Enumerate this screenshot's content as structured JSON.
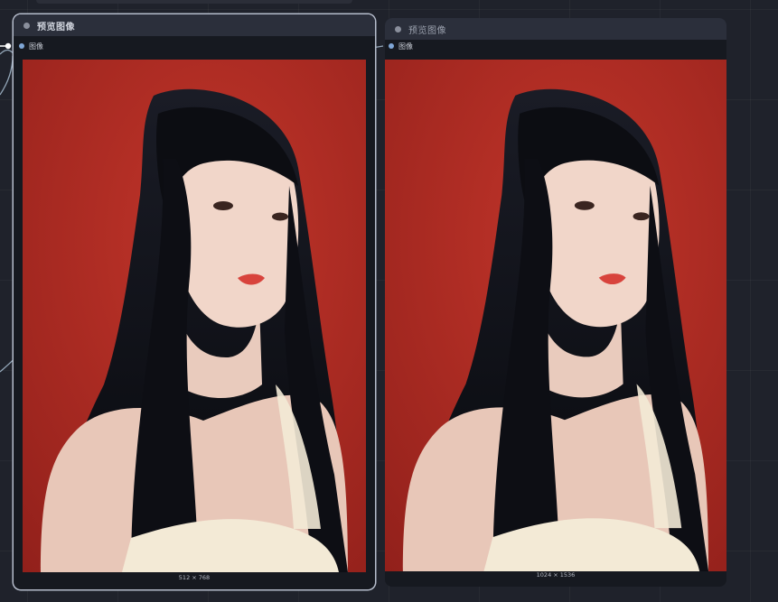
{
  "nodes": [
    {
      "title": "预览图像",
      "input_label": "图像",
      "image_size": "512 × 768"
    },
    {
      "title": "预览图像",
      "input_label": "图像",
      "image_size": "1024 × 1536"
    }
  ],
  "colors": {
    "canvas": "#1f222b",
    "node_body": "#161920",
    "node_header": "#2b2f3b",
    "slot": "#7fa6d6",
    "link": "#93a6b8",
    "backdrop_red": "#a8241f",
    "hair": "#0e0f14",
    "skin": "#f1d6c9"
  },
  "icons": [
    "collapse-dot-icon",
    "image-slot-icon"
  ]
}
